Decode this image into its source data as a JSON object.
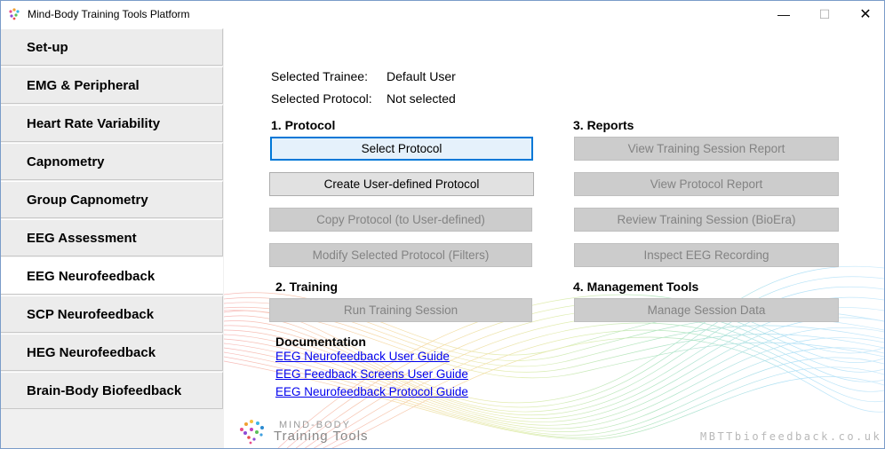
{
  "window": {
    "title": "Mind-Body Training Tools Platform",
    "minimize_glyph": "—",
    "maximize_glyph": "☐",
    "close_glyph": "✕"
  },
  "sidebar": {
    "items": [
      {
        "label": "Set-up",
        "active": false
      },
      {
        "label": "EMG & Peripheral",
        "active": false
      },
      {
        "label": "Heart Rate Variability",
        "active": false
      },
      {
        "label": "Capnometry",
        "active": false
      },
      {
        "label": "Group Capnometry",
        "active": false
      },
      {
        "label": "EEG Assessment",
        "active": false
      },
      {
        "label": "EEG Neurofeedback",
        "active": true
      },
      {
        "label": "SCP Neurofeedback",
        "active": false
      },
      {
        "label": "HEG Neurofeedback",
        "active": false
      },
      {
        "label": "Brain-Body Biofeedback",
        "active": false
      }
    ]
  },
  "info": {
    "trainee_label": "Selected Trainee:",
    "trainee_value": "Default User",
    "protocol_label": "Selected Protocol:",
    "protocol_value": "Not selected"
  },
  "protocol_section": {
    "heading": "1. Protocol",
    "select": "Select Protocol",
    "create": "Create User-defined Protocol",
    "copy": "Copy Protocol (to User-defined)",
    "modify": "Modify Selected Protocol (Filters)"
  },
  "training_section": {
    "heading": "2. Training",
    "run": "Run Training Session"
  },
  "reports_section": {
    "heading": "3. Reports",
    "view_session": "View Training Session Report",
    "view_protocol": "View Protocol Report",
    "review_session": "Review Training Session (BioEra)",
    "inspect_eeg": "Inspect EEG Recording"
  },
  "management_section": {
    "heading": "4. Management Tools",
    "manage": "Manage Session Data"
  },
  "documentation": {
    "heading": "Documentation",
    "links": [
      "EEG Neurofeedback User Guide",
      "EEG Feedback Screens User Guide",
      "EEG Neurofeedback Protocol Guide"
    ]
  },
  "branding": {
    "logo_top": "MIND-BODY",
    "logo_bottom": "Training Tools",
    "website": "MBTTbiofeedback.co.uk"
  },
  "colors": {
    "accent": "#0078d7",
    "link": "#0000ee",
    "disabled_button": "#cccccc",
    "enabled_button": "#e1e1e1"
  }
}
